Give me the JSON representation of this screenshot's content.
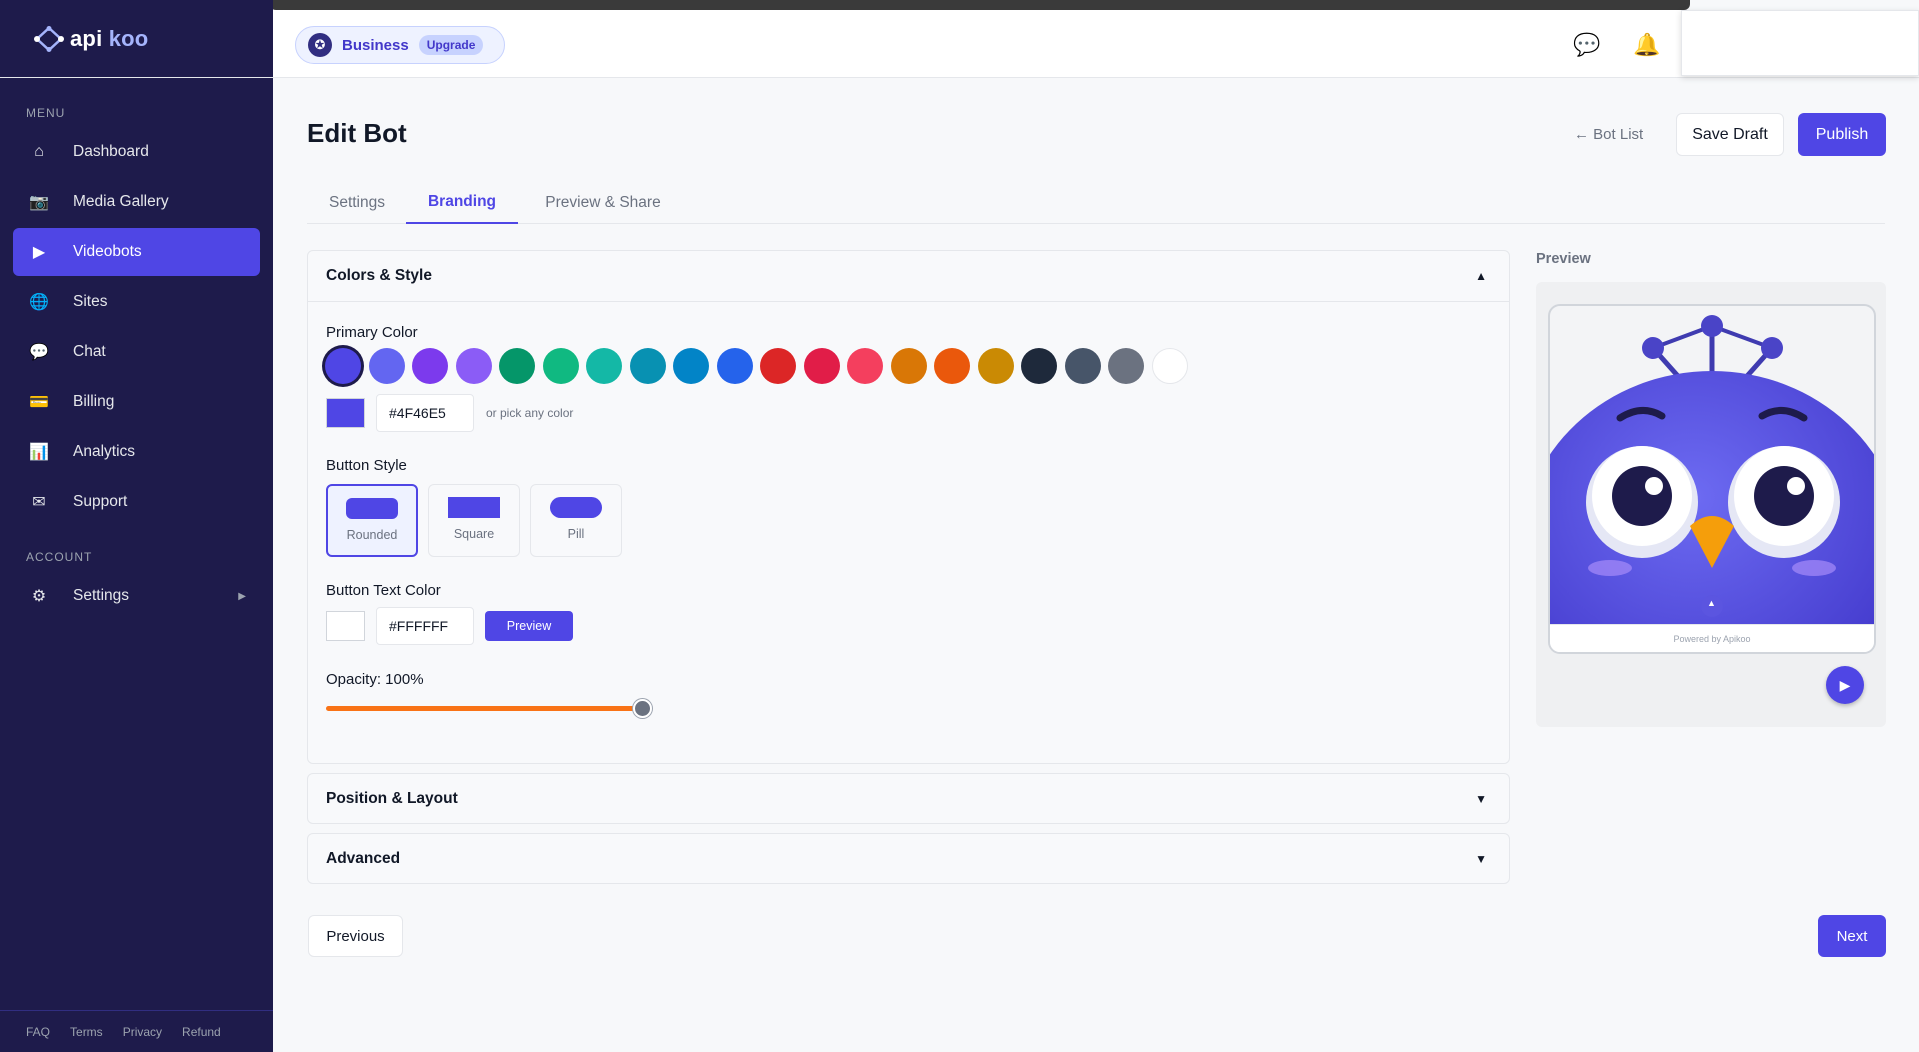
{
  "brand": {
    "logo_main": "api",
    "logo_accent": "koo"
  },
  "sidebar": {
    "menu_heading": "MENU",
    "items": [
      {
        "label": "Dashboard",
        "icon": "home-icon",
        "glyph": "⌂"
      },
      {
        "label": "Media Gallery",
        "icon": "camera-icon",
        "glyph": "📷"
      },
      {
        "label": "Videobots",
        "icon": "play-icon",
        "glyph": "▶",
        "active": true
      },
      {
        "label": "Sites",
        "icon": "globe-icon",
        "glyph": "🌐"
      },
      {
        "label": "Chat",
        "icon": "chat-icon",
        "glyph": "💬"
      },
      {
        "label": "Billing",
        "icon": "credit-card-icon",
        "glyph": "💳"
      },
      {
        "label": "Analytics",
        "icon": "bar-chart-icon",
        "glyph": "📊"
      },
      {
        "label": "Support",
        "icon": "envelope-icon",
        "glyph": "✉"
      }
    ],
    "account_heading": "ACCOUNT",
    "account_items": [
      {
        "label": "Settings",
        "icon": "gear-icon",
        "glyph": "⚙",
        "caret": "▶"
      }
    ],
    "footer_links": [
      "FAQ",
      "Terms",
      "Privacy",
      "Refund"
    ]
  },
  "header": {
    "plan_name": "Business",
    "upgrade_label": "Upgrade",
    "chat_glyph": "💬",
    "bell_glyph": "🔔"
  },
  "page": {
    "title": "Edit Bot",
    "back_link": "← Bot List",
    "save_draft": "Save Draft",
    "publish": "Publish"
  },
  "tabs": [
    {
      "label": "Settings",
      "active": false
    },
    {
      "label": "Branding",
      "active": true
    },
    {
      "label": "Preview & Share",
      "active": false
    }
  ],
  "colors_section": {
    "title": "Colors & Style",
    "toggle": "▲",
    "primary_color_label": "Primary Color",
    "swatches": [
      "#4F46E5",
      "#6366F1",
      "#7C3AED",
      "#8B5CF6",
      "#059669",
      "#10B981",
      "#14B8A6",
      "#0891B2",
      "#0284C7",
      "#2563EB",
      "#DC2626",
      "#E11D48",
      "#F43F5E",
      "#D97706",
      "#EA580C",
      "#CA8A04",
      "#1E293B",
      "#475569",
      "#6B7280",
      "#FFFFFF"
    ],
    "selected_swatch": 0,
    "primary_hex": "#4F46E5",
    "pick_hint": "or pick any color",
    "button_style_label": "Button Style",
    "button_styles": [
      {
        "label": "Rounded",
        "selected": true
      },
      {
        "label": "Square",
        "selected": false
      },
      {
        "label": "Pill",
        "selected": false
      }
    ],
    "button_text_color_label": "Button Text Color",
    "button_text_hex": "#FFFFFF",
    "preview_button": "Preview",
    "opacity_label": "Opacity: 100%",
    "opacity_value": 100
  },
  "position_section": {
    "title": "Position & Layout",
    "toggle": "▼"
  },
  "advanced_section": {
    "title": "Advanced",
    "toggle": "▼"
  },
  "footer_nav": {
    "previous": "Previous",
    "next": "Next"
  },
  "preview": {
    "title": "Preview",
    "powered_by": "Powered by Apikoo",
    "chevron": "▲",
    "play_glyph": "▶"
  },
  "colors": {
    "accent": "#4F46E5",
    "sidebar_bg": "#1E1B4B",
    "slider": "#F97316"
  }
}
